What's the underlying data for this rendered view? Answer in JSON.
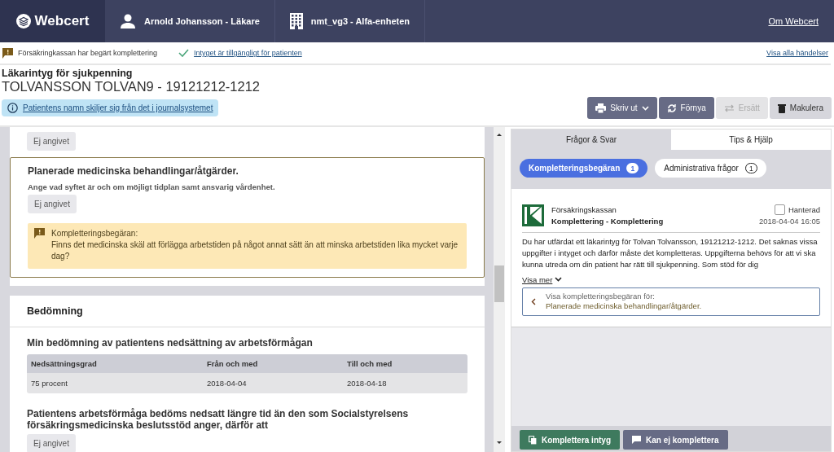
{
  "header": {
    "logo": "Webcert",
    "user": "Arnold Johansson - Läkare",
    "unit": "nmt_vg3 - Alfa-enheten",
    "about_link": "Om Webcert"
  },
  "events": [
    {
      "kind": "warning",
      "text": "Försäkringkassan har begärt komplettering"
    },
    {
      "kind": "check",
      "text": "Intyget är tillgängligt för patienten"
    }
  ],
  "all_events_link": "Visa alla händelser",
  "certificate": {
    "type": "Läkarintyg för sjukpenning",
    "patient": "TOLVANSSON TOLVAN9 - 19121212-1212"
  },
  "notice": "Patientens namn skiljer sig från det i journalsystemet",
  "actions": [
    {
      "kind": "print",
      "label": "Skriv ut",
      "disabled": false,
      "dropdown": true
    },
    {
      "kind": "renew",
      "label": "Förnya",
      "disabled": false,
      "dropdown": false
    },
    {
      "kind": "replace",
      "label": "Ersätt",
      "disabled": true,
      "dropdown": false
    },
    {
      "kind": "discard",
      "label": "Makulera",
      "disabled": false,
      "dropdown": false
    }
  ],
  "form": {
    "top_value": "Ej angivet",
    "highlighted_question": {
      "title": "Planerade medicinska behandlingar/åtgärder.",
      "hint": "Ange vad syftet är och om möjligt tidplan samt ansvarig vårdenhet.",
      "value": "Ej angivet",
      "request_label": "Kompletteringsbegäran:",
      "request_text": "Finns det medicinska skäl att förlägga arbetstiden på något annat sätt än att minska arbetstiden lika mycket varje dag?"
    },
    "section": {
      "title": "Bedömning",
      "table_title": "Min bedömning av patientens nedsättning av arbetsförmågan",
      "columns": [
        "Nedsättningsgrad",
        "Från och med",
        "Till och med"
      ],
      "rows": [
        [
          "75 procent",
          "2018-04-04",
          "2018-04-18"
        ]
      ],
      "question": "Patientens arbetsförmåga bedöms nedsatt längre tid än den som Socialstyrelsens försäkringsmedicinska beslutsstöd anger, därför att",
      "value": "Ej angivet"
    }
  },
  "sidebar": {
    "tabs": [
      {
        "label": "Frågor & Svar",
        "selected": true
      },
      {
        "label": "Tips & Hjälp",
        "selected": false
      }
    ],
    "filters": [
      {
        "label": "Kompletteringsbegäran",
        "count": "1",
        "selected": true
      },
      {
        "label": "Administrativa frågor",
        "count": "1",
        "selected": false
      }
    ],
    "message": {
      "sender": "Försäkringskassan",
      "subject": "Komplettering - Komplettering",
      "handled_label": "Hanterad",
      "handled": false,
      "date": "2018-04-04 16:05",
      "body": "Du har utfärdat ett läkarintyg för Tolvan Tolvansson, 19121212-1212. Det saknas vissa uppgifter i intyget och därför måste det kompletteras. Uppgifterna behövs för att vi ska kunna utreda om din patient har rätt till sjukpenning. Som stöd för dig",
      "more_link": "Visa mer",
      "reference_label": "Visa kompletteringsbegäran för:",
      "reference_target": "Planerade medicinska behandlingar/åtgärder."
    },
    "buttons": [
      {
        "kind": "primary",
        "label": "Komplettera intyg"
      },
      {
        "kind": "secondary",
        "label": "Kan ej komplettera"
      }
    ]
  }
}
